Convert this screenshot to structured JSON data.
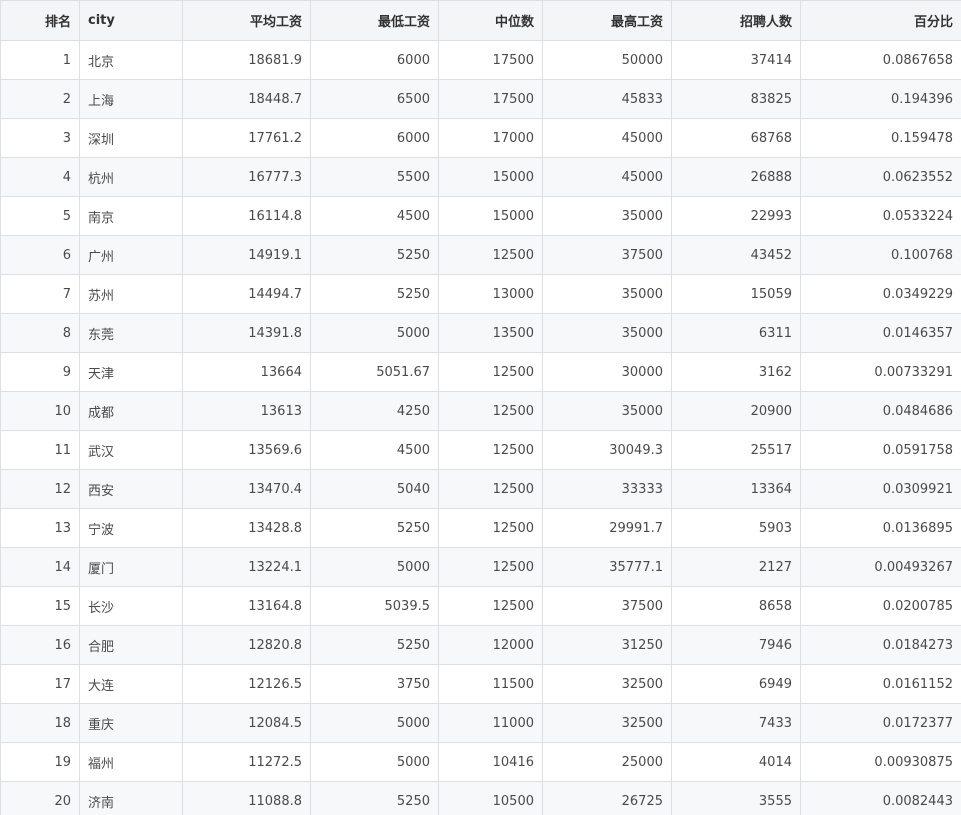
{
  "table": {
    "headers": [
      "排名",
      "city",
      "平均工资",
      "最低工资",
      "中位数",
      "最高工资",
      "招聘人数",
      "百分比"
    ],
    "rows": [
      [
        "1",
        "北京",
        "18681.9",
        "6000",
        "17500",
        "50000",
        "37414",
        "0.0867658"
      ],
      [
        "2",
        "上海",
        "18448.7",
        "6500",
        "17500",
        "45833",
        "83825",
        "0.194396"
      ],
      [
        "3",
        "深圳",
        "17761.2",
        "6000",
        "17000",
        "45000",
        "68768",
        "0.159478"
      ],
      [
        "4",
        "杭州",
        "16777.3",
        "5500",
        "15000",
        "45000",
        "26888",
        "0.0623552"
      ],
      [
        "5",
        "南京",
        "16114.8",
        "4500",
        "15000",
        "35000",
        "22993",
        "0.0533224"
      ],
      [
        "6",
        "广州",
        "14919.1",
        "5250",
        "12500",
        "37500",
        "43452",
        "0.100768"
      ],
      [
        "7",
        "苏州",
        "14494.7",
        "5250",
        "13000",
        "35000",
        "15059",
        "0.0349229"
      ],
      [
        "8",
        "东莞",
        "14391.8",
        "5000",
        "13500",
        "35000",
        "6311",
        "0.0146357"
      ],
      [
        "9",
        "天津",
        "13664",
        "5051.67",
        "12500",
        "30000",
        "3162",
        "0.00733291"
      ],
      [
        "10",
        "成都",
        "13613",
        "4250",
        "12500",
        "35000",
        "20900",
        "0.0484686"
      ],
      [
        "11",
        "武汉",
        "13569.6",
        "4500",
        "12500",
        "30049.3",
        "25517",
        "0.0591758"
      ],
      [
        "12",
        "西安",
        "13470.4",
        "5040",
        "12500",
        "33333",
        "13364",
        "0.0309921"
      ],
      [
        "13",
        "宁波",
        "13428.8",
        "5250",
        "12500",
        "29991.7",
        "5903",
        "0.0136895"
      ],
      [
        "14",
        "厦门",
        "13224.1",
        "5000",
        "12500",
        "35777.1",
        "2127",
        "0.00493267"
      ],
      [
        "15",
        "长沙",
        "13164.8",
        "5039.5",
        "12500",
        "37500",
        "8658",
        "0.0200785"
      ],
      [
        "16",
        "合肥",
        "12820.8",
        "5250",
        "12000",
        "31250",
        "7946",
        "0.0184273"
      ],
      [
        "17",
        "大连",
        "12126.5",
        "3750",
        "11500",
        "32500",
        "6949",
        "0.0161152"
      ],
      [
        "18",
        "重庆",
        "12084.5",
        "5000",
        "11000",
        "32500",
        "7433",
        "0.0172377"
      ],
      [
        "19",
        "福州",
        "11272.5",
        "5000",
        "10416",
        "25000",
        "4014",
        "0.00930875"
      ],
      [
        "20",
        "济南",
        "11088.8",
        "5250",
        "10500",
        "26725",
        "3555",
        "0.0082443"
      ]
    ]
  }
}
